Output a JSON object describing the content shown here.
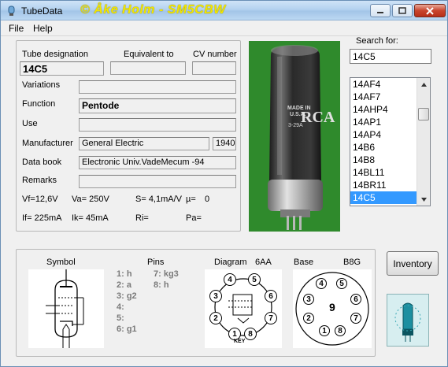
{
  "window": {
    "title": "TubeData",
    "credit": "© Åke Holm - SM5CBW"
  },
  "menu": {
    "file": "File",
    "help": "Help"
  },
  "details": {
    "designation_label": "Tube designation",
    "equivalent_label": "Equivalent to",
    "cv_label": "CV number",
    "designation_value": "14C5",
    "equivalent_value": "",
    "cv_value": "",
    "variations_label": "Variations",
    "variations_value": "",
    "function_label": "Function",
    "function_value": "Pentode",
    "use_label": "Use",
    "use_value": "",
    "manufacturer_label": "Manufacturer",
    "manufacturer_value": "General Electric",
    "year_value": "1940",
    "databook_label": "Data book",
    "databook_value": "Electronic Univ.VadeMecum -94",
    "remarks_label": "Remarks",
    "remarks_value": "",
    "vf": "Vf=12,6V",
    "va": "Va= 250V",
    "s": "S= 4,1mA/V",
    "mu": "µ=",
    "mu_value": "0",
    "if": "If= 225mA",
    "ik": "Ik=  45mA",
    "ri": "Ri=",
    "pa": "Pa="
  },
  "search": {
    "label": "Search for:",
    "value": "14C5",
    "results": [
      "14AF4",
      "14AF7",
      "14AHP4",
      "14AP1",
      "14AP4",
      "14B6",
      "14B8",
      "14BL11",
      "14BR11",
      "14C5"
    ],
    "selected_index": 9
  },
  "photo": {
    "brand": "RCA",
    "marking_1": "MADE IN",
    "marking_2": "U.S.A.",
    "marking_3": "3-29A"
  },
  "diagram_section": {
    "symbol_label": "Symbol",
    "pins_label": "Pins",
    "diagram_label": "Diagram",
    "diagram_code": "6AA",
    "base_label": "Base",
    "base_code": "B8G",
    "pins_left": [
      "1: h",
      "2: a",
      "3: g2",
      "4:",
      "5:",
      "6: g1"
    ],
    "pins_right": [
      "7: kg3",
      "8: h"
    ],
    "key_text": "KEY",
    "diagram_pins": [
      "1",
      "2",
      "3",
      "4",
      "5",
      "6",
      "7",
      "8"
    ]
  },
  "inventory_button": "Inventory"
}
